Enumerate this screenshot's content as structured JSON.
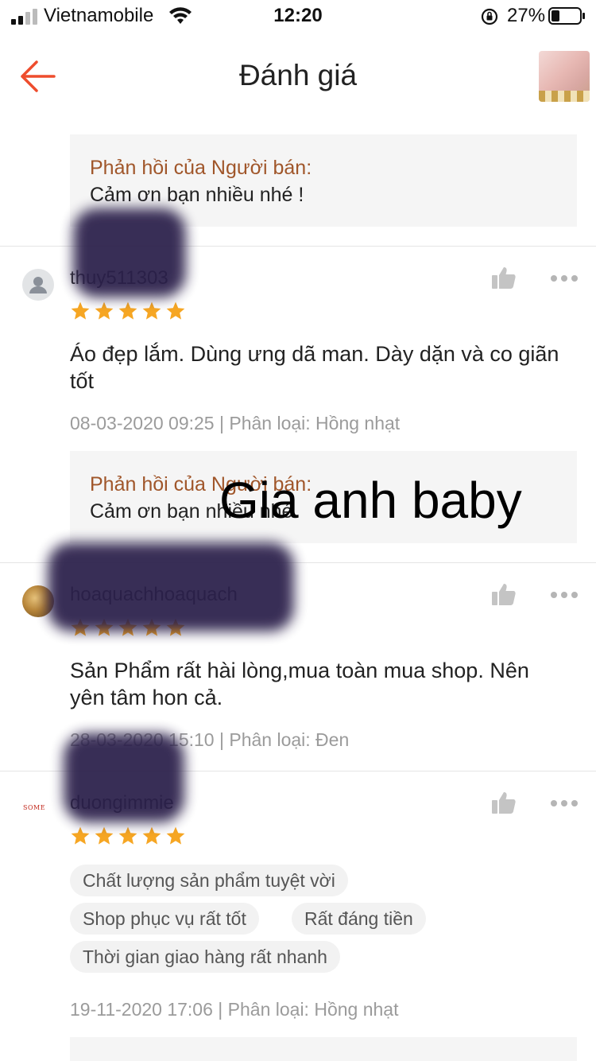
{
  "status_bar": {
    "carrier": "Vietnamobile",
    "time": "12:20",
    "battery": "27%"
  },
  "header": {
    "title": "Đánh giá",
    "back_icon": "arrow-left-icon",
    "accent_color": "#ee4d2d"
  },
  "top_reply": {
    "title": "Phản hồi của Người bán:",
    "text": "Cảm ơn bạn nhiều nhé !"
  },
  "reviews": [
    {
      "username": "thuy511303",
      "rating": 5,
      "text": "Áo đẹp lắm. Dùng ưng dã man. Dày dặn và co giãn tốt",
      "meta": "08-03-2020 09:25 | Phân loại: Hồng nhạt",
      "reply_title": "Phản hồi của Người bán:",
      "reply_text": "Cảm ơn bạn nhiều nhé."
    },
    {
      "username": "hoaquachhoaquach",
      "rating": 5,
      "text": "Sản Phẩm rất hài lòng,mua toàn mua shop. Nên yên tâm hon cả.",
      "meta": "28-03-2020 15:10 | Phân loại: Đen"
    },
    {
      "username": "duongimmie",
      "rating": 5,
      "avatar_logo_text": "SOME",
      "tags": [
        "Chất lượng sản phẩm tuyệt vời",
        "Shop phục vụ rất tốt",
        "Rất đáng tiền",
        "Thời gian giao hàng rất nhanh"
      ],
      "meta": "19-11-2020 17:06 | Phân loại: Hồng nhạt"
    }
  ],
  "watermark": "Gia anh baby",
  "colors": {
    "star": "#f6a623",
    "reply_title": "#a0562a",
    "meta": "#9b9b9b"
  }
}
